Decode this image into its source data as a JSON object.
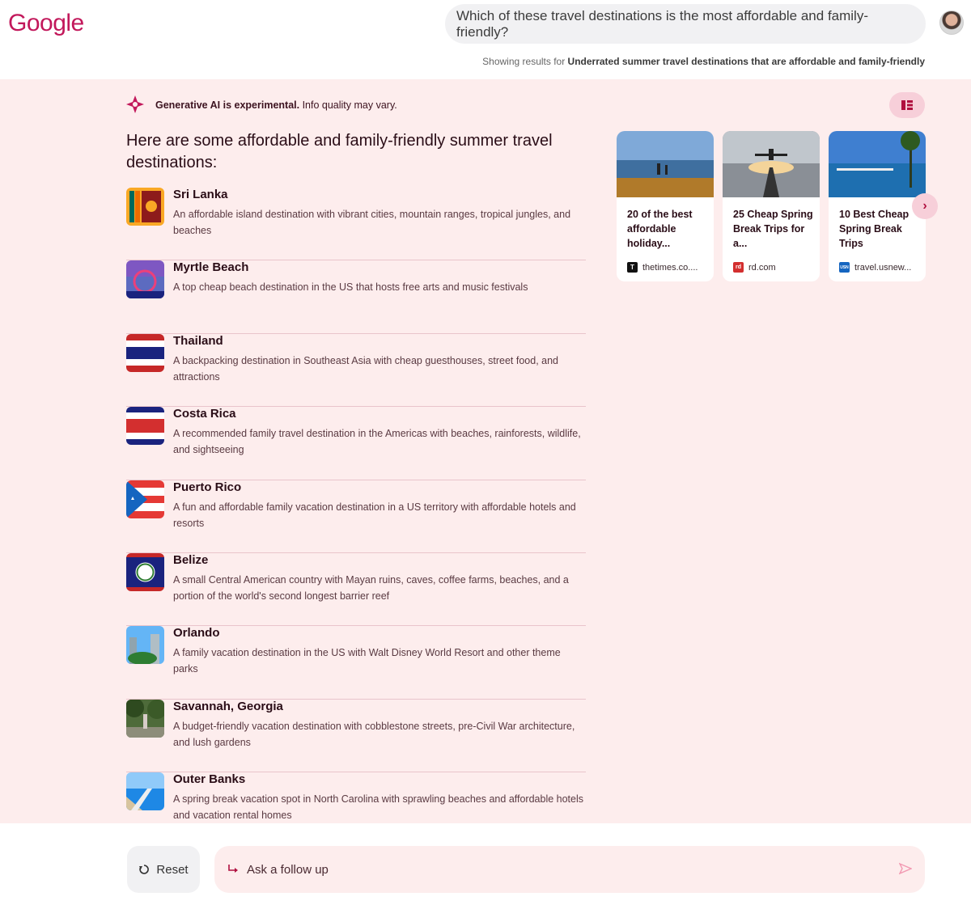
{
  "header": {
    "logo": "Google",
    "query": "Which of these travel destinations is the most affordable and family-friendly?",
    "showing_prefix": "Showing results for",
    "showing_query": "Underrated summer travel destinations that are affordable and family-friendly"
  },
  "ai": {
    "notice_bold": "Generative AI is experimental.",
    "notice_rest": " Info quality may vary.",
    "headline": "Here are some affordable and family-friendly summer travel destinations:",
    "items": [
      {
        "name": "Sri Lanka",
        "desc": "An affordable island destination with vibrant cities, mountain ranges, tropical jungles, and beaches"
      },
      {
        "name": "Myrtle Beach",
        "desc": "A top cheap beach destination in the US that hosts free arts and music festivals"
      },
      {
        "name": "Thailand",
        "desc": "A backpacking destination in Southeast Asia with cheap guesthouses, street food, and attractions"
      },
      {
        "name": "Costa Rica",
        "desc": "A recommended family travel destination in the Americas with beaches, rainforests, wildlife, and sightseeing"
      },
      {
        "name": "Puerto Rico",
        "desc": "A fun and affordable family vacation destination in a US territory with affordable hotels and resorts"
      },
      {
        "name": "Belize",
        "desc": "A small Central American country with Mayan ruins, caves, coffee farms, beaches, and a portion of the world's second longest barrier reef"
      },
      {
        "name": "Orlando",
        "desc": "A family vacation destination in the US with Walt Disney World Resort and other theme parks"
      },
      {
        "name": "Savannah, Georgia",
        "desc": "A budget-friendly vacation destination with cobblestone streets, pre-Civil War architecture, and lush gardens"
      },
      {
        "name": "Outer Banks",
        "desc": "A spring break vacation spot in North Carolina with sprawling beaches and affordable hotels and vacation rental homes"
      }
    ]
  },
  "sources": [
    {
      "title": "20 of the best affordable holiday...",
      "site": "thetimes.co....",
      "favicon": "T"
    },
    {
      "title": "25 Cheap Spring Break Trips for a...",
      "site": "rd.com",
      "favicon": "rd"
    },
    {
      "title": "10 Best Cheap Spring Break Trips",
      "site": "travel.usnew...",
      "favicon": "USN"
    }
  ],
  "footer": {
    "reset_label": "Reset",
    "follow_placeholder": "Ask a follow up"
  },
  "colors": {
    "accent": "#c2185b",
    "panel_bg": "#fdeded"
  }
}
